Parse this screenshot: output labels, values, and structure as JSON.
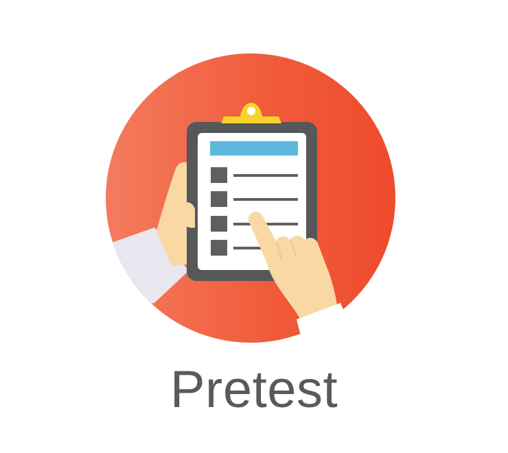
{
  "label": "Pretest",
  "icon": {
    "name": "clipboard-checklist-icon",
    "colors": {
      "circle_light": "#f47b5f",
      "circle_dark": "#ee4b2b",
      "board": "#565759",
      "paper": "#ffffff",
      "header_bar": "#5db8dd",
      "clip": "#f9d32d",
      "checkbox": "#5f5f62",
      "line": "#5f5f62",
      "skin": "#f9d8a3",
      "sleeve": "#e8e6ee"
    }
  }
}
